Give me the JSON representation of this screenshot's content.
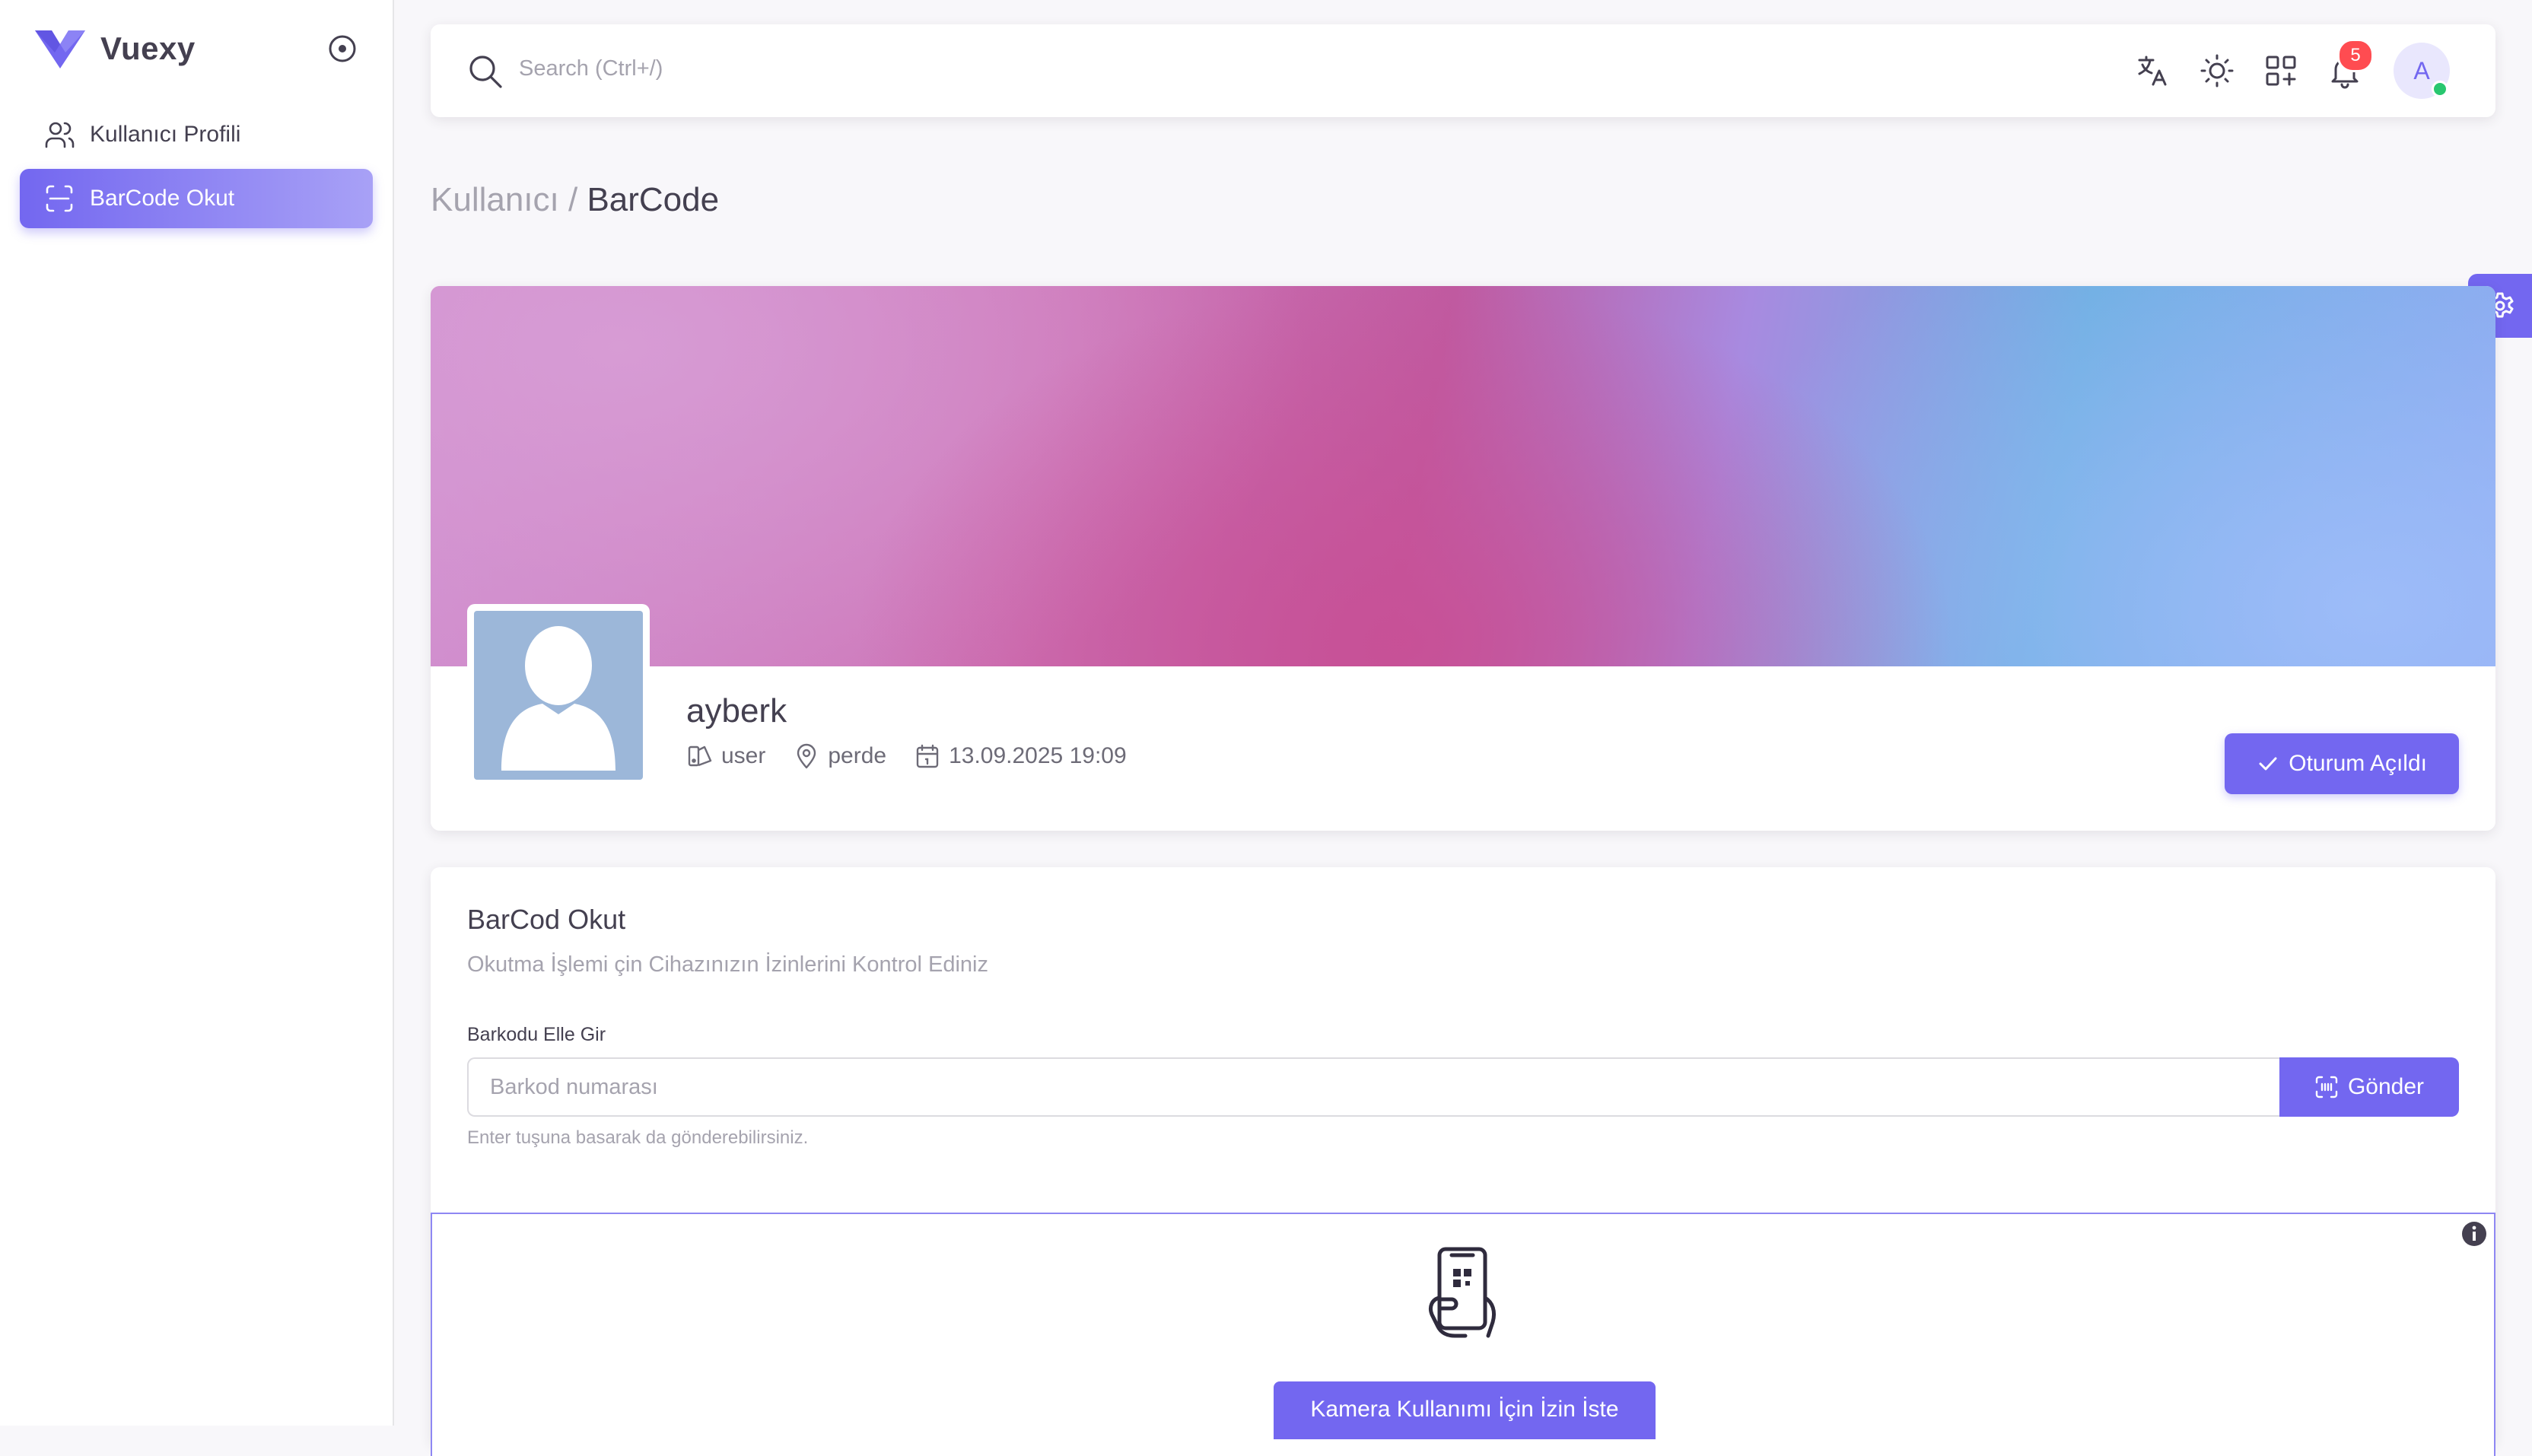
{
  "brand": {
    "name": "Vuexy"
  },
  "sidebar": {
    "items": [
      {
        "label": "Kullanıcı Profili",
        "icon": "users-icon",
        "active": false
      },
      {
        "label": "BarCode Okut",
        "icon": "scan-icon",
        "active": true
      }
    ]
  },
  "navbar": {
    "search_placeholder": "Search (Ctrl+/)",
    "notification_count": "5",
    "avatar_initial": "A"
  },
  "breadcrumb": {
    "parent": "Kullanıcı / ",
    "current": "BarCode"
  },
  "profile": {
    "name": "ayberk",
    "role": "user",
    "location": "perde",
    "datetime": "13.09.2025 19:09",
    "session_button": "Oturum Açıldı"
  },
  "barcode": {
    "title": "BarCod Okut",
    "subtitle": "Okutma İşlemi çin Cihazınızın İzinlerini Kontrol Ediniz",
    "field_label": "Barkodu Elle Gir",
    "input_placeholder": "Barkod numarası",
    "input_value": "",
    "send_button": "Gönder",
    "helper": "Enter tuşuna basarak da gönderebilirsiniz.",
    "permission_button": "Kamera Kullanımı İçin İzin İste"
  },
  "colors": {
    "primary": "#7367f0",
    "danger": "#ff4c51",
    "success": "#28c76f",
    "background": "#f8f7fa"
  }
}
